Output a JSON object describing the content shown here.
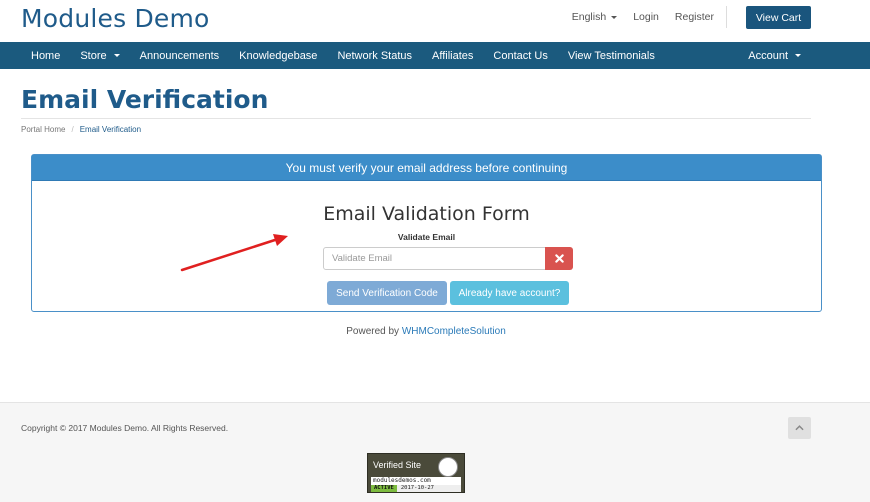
{
  "header": {
    "logo": "Modules Demo",
    "language": "English",
    "login": "Login",
    "register": "Register",
    "view_cart": "View Cart"
  },
  "nav": {
    "items": [
      {
        "label": "Home",
        "dropdown": false
      },
      {
        "label": "Store",
        "dropdown": true
      },
      {
        "label": "Announcements",
        "dropdown": false
      },
      {
        "label": "Knowledgebase",
        "dropdown": false
      },
      {
        "label": "Network Status",
        "dropdown": false
      },
      {
        "label": "Affiliates",
        "dropdown": false
      },
      {
        "label": "Contact Us",
        "dropdown": false
      },
      {
        "label": "View Testimonials",
        "dropdown": false
      }
    ],
    "account": "Account"
  },
  "page": {
    "title": "Email Verification",
    "breadcrumb": [
      "Portal Home",
      "Email Verification"
    ]
  },
  "panel": {
    "heading": "You must verify your email address before continuing",
    "form_title": "Email Validation Form",
    "field_label": "Validate Email",
    "input_value": "",
    "input_placeholder": "Validate Email",
    "send_button": "Send Verification Code",
    "have_account_button": "Already have account?"
  },
  "powered": {
    "prefix": "Powered by ",
    "link": "WHMCompleteSolution"
  },
  "footer": {
    "copyright": "Copyright © 2017 Modules Demo. All Rights Reserved.",
    "seal": {
      "title": "Verified Site",
      "domain": "modulesdemos.com",
      "status": "ACTIVE",
      "date": "2017-10-27"
    }
  },
  "colors": {
    "brand": "#1f5b8a",
    "navbar": "#1b5a7e",
    "panel_header": "#3c8dc9",
    "danger": "#d9534f",
    "primary_button": "#7eaad6",
    "info_button": "#5bc0de",
    "arrow": "#e02020"
  },
  "icons": {
    "clear": "times-icon",
    "back_to_top": "chevron-up-icon",
    "annotation": "red-arrow"
  }
}
